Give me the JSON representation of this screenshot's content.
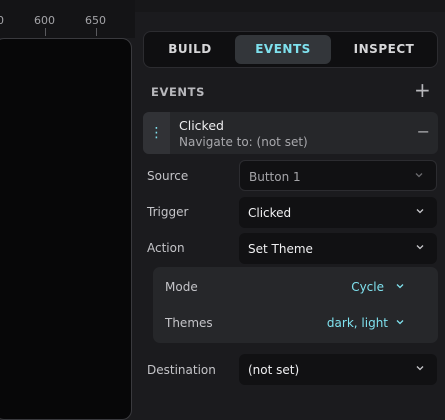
{
  "ruler": {
    "ticks": [
      "0",
      "600",
      "650"
    ]
  },
  "tabs": [
    {
      "label": "BUILD",
      "active": false
    },
    {
      "label": "EVENTS",
      "active": true
    },
    {
      "label": "INSPECT",
      "active": false
    }
  ],
  "events_section": {
    "title": "EVENTS",
    "add_icon": "plus-icon"
  },
  "event": {
    "title": "Clicked",
    "subtitle": "Navigate to: (not set)"
  },
  "fields": {
    "source": {
      "label": "Source",
      "value": "Button 1"
    },
    "trigger": {
      "label": "Trigger",
      "value": "Clicked"
    },
    "action": {
      "label": "Action",
      "value": "Set Theme"
    },
    "destination": {
      "label": "Destination",
      "value": "(not set)"
    }
  },
  "theme_options": {
    "mode": {
      "label": "Mode",
      "value": "Cycle"
    },
    "themes": {
      "label": "Themes",
      "value": "dark, light"
    }
  },
  "colors": {
    "accent": "#7fe1ee",
    "panel": "#1b1b1e",
    "card": "#26272a"
  }
}
